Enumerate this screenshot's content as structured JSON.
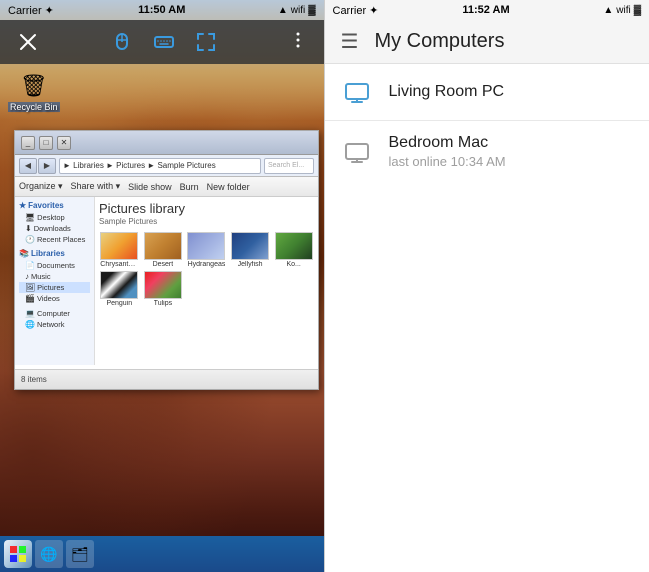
{
  "left": {
    "status_bar": {
      "carrier": "Carrier ✦",
      "time": "11:50 AM",
      "battery": "▌▌▌▌",
      "signal": "●●●●○"
    },
    "toolbar": {
      "close_label": "✕",
      "mouse_icon": "mouse",
      "keyboard_icon": "keyboard",
      "expand_icon": "expand",
      "more_icon": "more"
    },
    "explorer": {
      "path": "► Libraries ► Pictures ► Sample Pictures",
      "search_placeholder": "Search El...",
      "toolbar_items": [
        "Organize ▾",
        "Share with ▾",
        "Slide show",
        "Burn",
        "New folder"
      ],
      "heading": "Pictures library",
      "subheading": "Sample Pictures",
      "files": [
        {
          "name": "Chrysanthemum",
          "thumb": "chrysanthemum"
        },
        {
          "name": "Desert",
          "thumb": "desert"
        },
        {
          "name": "Hydrangeas",
          "thumb": "hydrangeas"
        },
        {
          "name": "Jellyfish",
          "thumb": "jellyfish"
        },
        {
          "name": "Ko...",
          "thumb": "kookaburra"
        },
        {
          "name": "Penguin",
          "thumb": "penguin"
        },
        {
          "name": "Tulips",
          "thumb": "tulips"
        }
      ],
      "sidebar_sections": [
        {
          "title": "Favorites",
          "items": [
            "Desktop",
            "Downloads",
            "Recent Places"
          ]
        },
        {
          "title": "Libraries",
          "items": [
            "Documents",
            "Music",
            "Pictures",
            "Videos"
          ]
        },
        {
          "title": "",
          "items": [
            "Computer",
            "Network"
          ]
        }
      ],
      "status": "8 items"
    },
    "desktop_icons": [
      {
        "label": "Recycle Bin",
        "icon": "🗑"
      }
    ],
    "taskbar_icons": [
      "⊞",
      "🌐",
      "🪟"
    ]
  },
  "right": {
    "status_bar": {
      "carrier": "Carrier ✦",
      "time": "11:52 AM",
      "battery": "▌▌▌▌▌",
      "signal": "●●●●●"
    },
    "header": {
      "menu_icon": "☰",
      "title": "My Computers"
    },
    "computers": [
      {
        "name": "Living Room PC",
        "status": "online",
        "status_label": ""
      },
      {
        "name": "Bedroom Mac",
        "status": "offline",
        "status_label": "last online 10:34 AM"
      }
    ]
  }
}
